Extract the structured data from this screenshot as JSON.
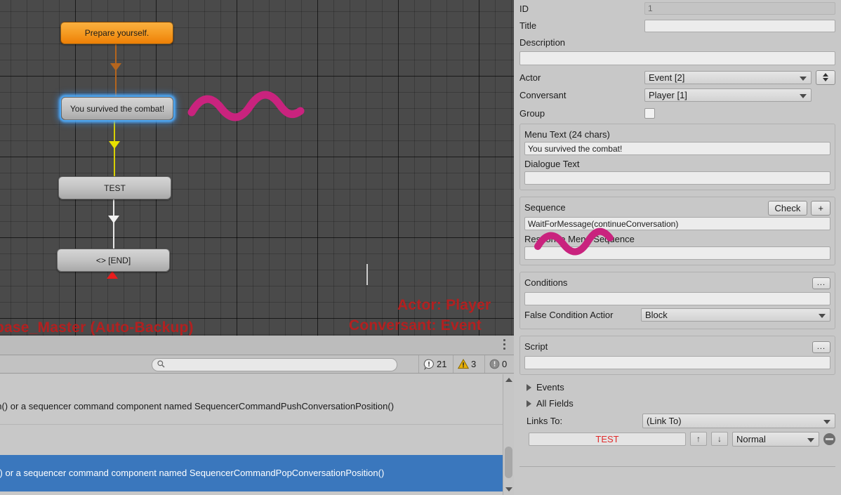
{
  "canvas": {
    "nodes": [
      {
        "label": "Prepare yourself.",
        "style": "orange"
      },
      {
        "label": "You survived the combat!",
        "style": "selected"
      },
      {
        "label": "TEST",
        "style": "grey"
      },
      {
        "label": "<> [END]",
        "style": "grey"
      }
    ],
    "overlay": {
      "database_label": "base_Master (Auto-Backup)",
      "actor_label": "Actor: Player",
      "conversant_label": "Conversant: Event"
    }
  },
  "console": {
    "search_placeholder": "",
    "search_value": "",
    "counts": {
      "errors": "21",
      "warnings": "3",
      "infos": "0"
    },
    "icons": {
      "search": "search-icon",
      "error": "error-icon",
      "warning": "warning-icon",
      "info": "info-icon",
      "kebab": "kebab-menu-icon"
    },
    "rows": [
      {
        "text": "on() or a sequencer command component named SequencerCommandPushConversationPosition()",
        "selected": false
      },
      {
        "text": "n() or a sequencer command component named SequencerCommandPopConversationPosition()",
        "selected": true
      }
    ]
  },
  "inspector": {
    "id": {
      "label": "ID",
      "value": "1"
    },
    "title": {
      "label": "Title",
      "value": ""
    },
    "description": {
      "label": "Description",
      "value": ""
    },
    "actor": {
      "label": "Actor",
      "value": "Event [2]"
    },
    "conversant": {
      "label": "Conversant",
      "value": "Player [1]"
    },
    "group": {
      "label": "Group",
      "checked": false
    },
    "menu_text": {
      "label": "Menu Text (24 chars)",
      "value": "You survived the combat!"
    },
    "dialogue_text": {
      "label": "Dialogue Text",
      "value": ""
    },
    "sequence": {
      "label": "Sequence",
      "check_label": "Check",
      "add_label": "+",
      "value": "WaitForMessage(continueConversation)",
      "response_menu_label": "Response Menu Sequence",
      "response_menu_value": ""
    },
    "conditions": {
      "label": "Conditions",
      "more_label": "...",
      "value": "",
      "false_condition_label": "False Condition Actior",
      "false_condition_value": "Block"
    },
    "script": {
      "label": "Script",
      "more_label": "...",
      "value": ""
    },
    "events_foldout": "Events",
    "all_fields_foldout": "All Fields",
    "links_to": {
      "label": "Links To:",
      "dropdown_value": "(Link To)",
      "link_name": "TEST",
      "up_label": "↑",
      "down_label": "↓",
      "priority_value": "Normal"
    }
  },
  "colors": {
    "accent_selected_row": "#3a77bd",
    "node_orange": "#f59b22",
    "node_selected_glow": "#50afff",
    "red_overlay": "#b32020",
    "link_red": "#e02b2b",
    "annotation_magenta": "#c9237e"
  }
}
